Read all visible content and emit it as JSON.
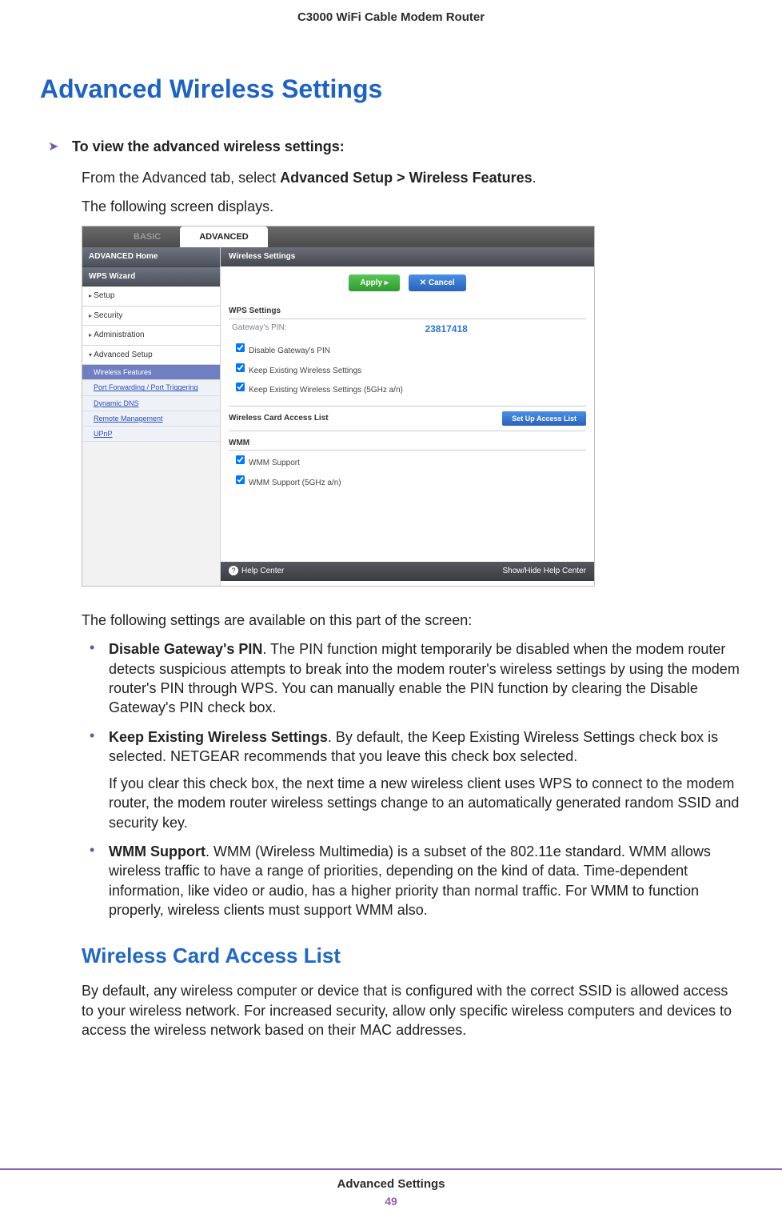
{
  "header": {
    "running": "C3000 WiFi Cable Modem Router"
  },
  "h1": "Advanced Wireless Settings",
  "procedure": {
    "task": "To view the advanced wireless settings:",
    "line_prefix": "From the Advanced tab, select ",
    "line_bold": "Advanced Setup > Wireless Features",
    "line_suffix": ".",
    "after": "The following screen displays."
  },
  "screenshot": {
    "tabs": {
      "basic": "BASIC",
      "advanced": "ADVANCED"
    },
    "sidebar": {
      "home": "ADVANCED Home",
      "wps": "WPS Wizard",
      "items": [
        "Setup",
        "Security",
        "Administration",
        "Advanced Setup"
      ],
      "subs": {
        "active": "Wireless Features",
        "others": [
          "Port Forwarding / Port Triggering",
          "Dynamic DNS",
          "Remote Management",
          "UPnP"
        ]
      }
    },
    "panel": {
      "title": "Wireless Settings",
      "apply": "Apply ▸",
      "cancel": "✕ Cancel",
      "wps_head": "WPS Settings",
      "pin_label": "Gateway's PIN:",
      "pin_value": "23817418",
      "cb": [
        "Disable Gateway's PIN",
        "Keep Existing Wireless Settings",
        "Keep Existing Wireless Settings (5GHz a/n)"
      ],
      "acl_label": "Wireless Card Access List",
      "acl_btn": "Set Up Access List",
      "wmm_head": "WMM",
      "wmm_cb": [
        "WMM Support",
        "WMM Support (5GHz a/n)"
      ],
      "help_left": "Help Center",
      "help_right": "Show/Hide Help Center"
    }
  },
  "settings_intro": "The following settings are available on this part of the screen:",
  "settings": [
    {
      "term": "Disable Gateway's PIN",
      "text": ". The PIN function might temporarily be disabled when the modem router detects suspicious attempts to break into the modem router's wireless settings by using the modem router's PIN through WPS. You can manually enable the PIN function by clearing the Disable Gateway's PIN check box."
    },
    {
      "term": "Keep Existing Wireless Settings",
      "text": ". By default, the Keep Existing Wireless Settings check box is selected. NETGEAR recommends that you leave this check box selected.",
      "extra": "If you clear this check box, the next time a new wireless client uses WPS to connect to the modem router, the modem router wireless settings change to an automatically generated random SSID and security key."
    },
    {
      "term": "WMM Support",
      "text": ". WMM (Wireless Multimedia) is a subset of the 802.11e standard. WMM allows wireless traffic to have a range of priorities, depending on the kind of data. Time-dependent information, like video or audio, has a higher priority than normal traffic. For WMM to function properly, wireless clients must support WMM also."
    }
  ],
  "h2": "Wireless Card Access List",
  "acl_para": "By default, any wireless computer or device that is configured with the correct SSID is allowed access to your wireless network. For increased security, allow only specific wireless computers and devices to access the wireless network based on their MAC addresses.",
  "footer": {
    "section": "Advanced Settings",
    "page": "49"
  }
}
